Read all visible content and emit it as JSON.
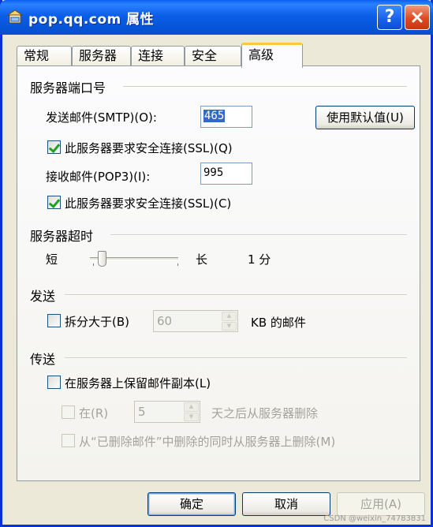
{
  "window": {
    "title": "pop.qq.com 属性",
    "help_glyph": "?"
  },
  "tabs": [
    {
      "label": "常规"
    },
    {
      "label": "服务器"
    },
    {
      "label": "连接"
    },
    {
      "label": "安全"
    },
    {
      "label": "高级"
    }
  ],
  "ports": {
    "section_title": "服务器端口号",
    "smtp_label": "发送邮件(SMTP)(O):",
    "smtp_value": "465",
    "default_button": "使用默认值(U)",
    "smtp_ssl_label": "此服务器要求安全连接(SSL)(Q)",
    "pop3_label": "接收邮件(POP3)(I):",
    "pop3_value": "995",
    "pop3_ssl_label": "此服务器要求安全连接(SSL)(C)"
  },
  "timeout": {
    "section_title": "服务器超时",
    "short_label": "短",
    "long_label": "长",
    "value_label": "1 分",
    "slider_fraction": 0.1
  },
  "sending": {
    "section_title": "发送",
    "split_label": "拆分大于(B)",
    "split_value": "60",
    "split_unit": "KB 的邮件"
  },
  "delivery": {
    "section_title": "传送",
    "keep_copy_label": "在服务器上保留邮件副本(L)",
    "remove_after_label": "在(R)",
    "remove_after_value": "5",
    "remove_after_unit": "天之后从服务器删除",
    "remove_deleted_label": "从“已删除邮件”中删除的同时从服务器上删除(M)"
  },
  "footer": {
    "ok": "确定",
    "cancel": "取消",
    "apply": "应用(A)"
  },
  "watermark": "CSDN @weixin_74783831"
}
